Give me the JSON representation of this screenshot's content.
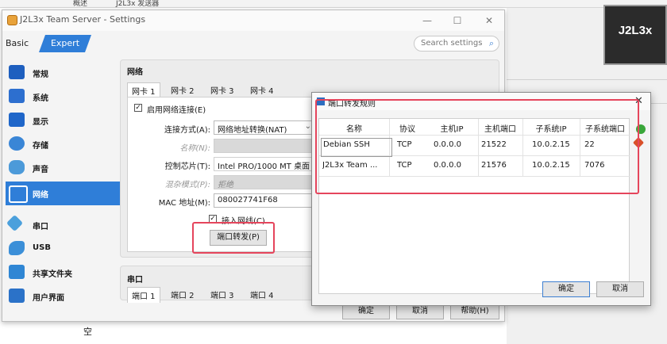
{
  "background": {
    "top_tabs": [
      "概述",
      "J2L3x 发送器"
    ],
    "tile_label": "J2L3x",
    "bottom_text": "空"
  },
  "window": {
    "title": "J2L3x Team Server - Settings",
    "minimize": "—",
    "maximize": "☐",
    "close": "✕",
    "mode_basic": "Basic",
    "mode_expert": "Expert",
    "search_placeholder": "Search settings"
  },
  "sidebar": {
    "items": [
      {
        "label": "常规",
        "icon": "monitor-icon",
        "color": "#1e5fbf"
      },
      {
        "label": "系统",
        "icon": "chip-icon",
        "color": "#2d6fcf"
      },
      {
        "label": "显示",
        "icon": "display-icon",
        "color": "#1f66c9"
      },
      {
        "label": "存储",
        "icon": "storage-icon",
        "color": "#3a86d6"
      },
      {
        "label": "声音",
        "icon": "speaker-icon",
        "color": "#4c9ad9"
      },
      {
        "label": "网络",
        "icon": "network-icon",
        "color": "#ffffff",
        "selected": true
      },
      {
        "label": "串口",
        "icon": "serial-port-icon",
        "color": "#4ba0dc"
      },
      {
        "label": "USB",
        "icon": "usb-icon",
        "color": "#3b8fd8"
      },
      {
        "label": "共享文件夹",
        "icon": "folder-icon",
        "color": "#2f86d4"
      },
      {
        "label": "用户界面",
        "icon": "ui-icon",
        "color": "#2b72c8"
      }
    ]
  },
  "network": {
    "header": "网络",
    "tabs": [
      "网卡 1",
      "网卡 2",
      "网卡 3",
      "网卡 4"
    ],
    "enable_label": "启用网络连接(E)",
    "attach_label": "连接方式(A):",
    "attach_value": "网络地址转换(NAT)",
    "name_label": "名称(N):",
    "adapter_label": "控制芯片(T):",
    "adapter_value": "Intel PRO/1000 MT 桌面 (8",
    "promisc_label": "混杂模式(P):",
    "promisc_value": "拒绝",
    "mac_label": "MAC 地址(M):",
    "mac_value": "080027741F68",
    "cable_label": "接入网线(C)",
    "port_forward_button": "端口转发(P)"
  },
  "serial": {
    "header": "串口",
    "tabs": [
      "端口 1",
      "端口 2",
      "端口 3",
      "端口 4"
    ]
  },
  "footer": {
    "ok": "确定",
    "cancel": "取消",
    "help": "帮助(H)"
  },
  "dialog": {
    "title": "端口转发规则",
    "close": "✕",
    "columns": [
      "名称",
      "协议",
      "主机IP",
      "主机端口",
      "子系统IP",
      "子系统端口"
    ],
    "rows": [
      [
        "Debian SSH",
        "TCP",
        "0.0.0.0",
        "21522",
        "10.0.2.15",
        "22"
      ],
      [
        "J2L3x Team ...",
        "TCP",
        "0.0.0.0",
        "21576",
        "10.0.2.15",
        "7076"
      ]
    ],
    "ok": "确定",
    "cancel": "取消"
  },
  "colors": {
    "accent": "#2f7ed8",
    "highlight": "#e5455c",
    "add_rule": "#3aa63a",
    "remove_rule": "#d9502a"
  }
}
